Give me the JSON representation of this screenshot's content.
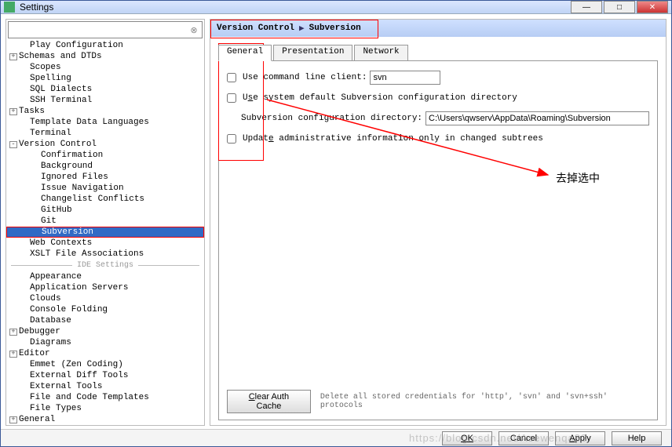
{
  "window": {
    "title": "Settings"
  },
  "tree": {
    "items": [
      {
        "l": "Play Configuration",
        "i": 1,
        "e": ""
      },
      {
        "l": "Schemas and DTDs",
        "i": 0,
        "e": "+"
      },
      {
        "l": "Scopes",
        "i": 1,
        "e": ""
      },
      {
        "l": "Spelling",
        "i": 1,
        "e": ""
      },
      {
        "l": "SQL Dialects",
        "i": 1,
        "e": ""
      },
      {
        "l": "SSH Terminal",
        "i": 1,
        "e": ""
      },
      {
        "l": "Tasks",
        "i": 0,
        "e": "+"
      },
      {
        "l": "Template Data Languages",
        "i": 1,
        "e": ""
      },
      {
        "l": "Terminal",
        "i": 1,
        "e": ""
      },
      {
        "l": "Version Control",
        "i": 0,
        "e": "-"
      },
      {
        "l": "Confirmation",
        "i": 2,
        "e": ""
      },
      {
        "l": "Background",
        "i": 2,
        "e": ""
      },
      {
        "l": "Ignored Files",
        "i": 2,
        "e": ""
      },
      {
        "l": "Issue Navigation",
        "i": 2,
        "e": ""
      },
      {
        "l": "Changelist Conflicts",
        "i": 2,
        "e": ""
      },
      {
        "l": "GitHub",
        "i": 2,
        "e": ""
      },
      {
        "l": "Git",
        "i": 2,
        "e": ""
      },
      {
        "l": "Subversion",
        "i": 2,
        "e": "",
        "sel": true,
        "red": true
      },
      {
        "l": "Web Contexts",
        "i": 1,
        "e": ""
      },
      {
        "l": "XSLT File Associations",
        "i": 1,
        "e": ""
      }
    ],
    "divider": "IDE Settings",
    "ide_items": [
      {
        "l": "Appearance",
        "i": 1,
        "e": ""
      },
      {
        "l": "Application Servers",
        "i": 1,
        "e": ""
      },
      {
        "l": "Clouds",
        "i": 1,
        "e": ""
      },
      {
        "l": "Console Folding",
        "i": 1,
        "e": ""
      },
      {
        "l": "Database",
        "i": 1,
        "e": ""
      },
      {
        "l": "Debugger",
        "i": 0,
        "e": "+"
      },
      {
        "l": "Diagrams",
        "i": 1,
        "e": ""
      },
      {
        "l": "Editor",
        "i": 0,
        "e": "+"
      },
      {
        "l": "Emmet (Zen Coding)",
        "i": 1,
        "e": ""
      },
      {
        "l": "External Diff Tools",
        "i": 1,
        "e": ""
      },
      {
        "l": "External Tools",
        "i": 1,
        "e": ""
      },
      {
        "l": "File and Code Templates",
        "i": 1,
        "e": ""
      },
      {
        "l": "File Types",
        "i": 1,
        "e": ""
      },
      {
        "l": "General",
        "i": 0,
        "e": "+"
      }
    ]
  },
  "breadcrumb": {
    "a": "Version Control",
    "b": "Subversion",
    "sep": "▶"
  },
  "tabs": {
    "general": "General",
    "presentation": "Presentation",
    "network": "Network"
  },
  "form": {
    "cli_label": "Use command line client:",
    "cli_value": "svn",
    "sysdefault_label": "Use system default Subversion configuration directory",
    "dir_label": "Subversion configuration directory:",
    "dir_value": "C:\\Users\\qwserv\\AppData\\Roaming\\Subversion",
    "update_label": "Update administrative information only in changed subtrees",
    "clear_btn": "Clear Auth Cache",
    "clear_hint": "Delete all stored credentials for 'http', 'svn' and 'svn+ssh' protocols"
  },
  "annotation": "去掉选中",
  "footer": {
    "ok": "OK",
    "cancel": "Cancel",
    "apply": "Apply",
    "help": "Help"
  },
  "watermark": "https://blog.csdn.net/Asewenqa83"
}
